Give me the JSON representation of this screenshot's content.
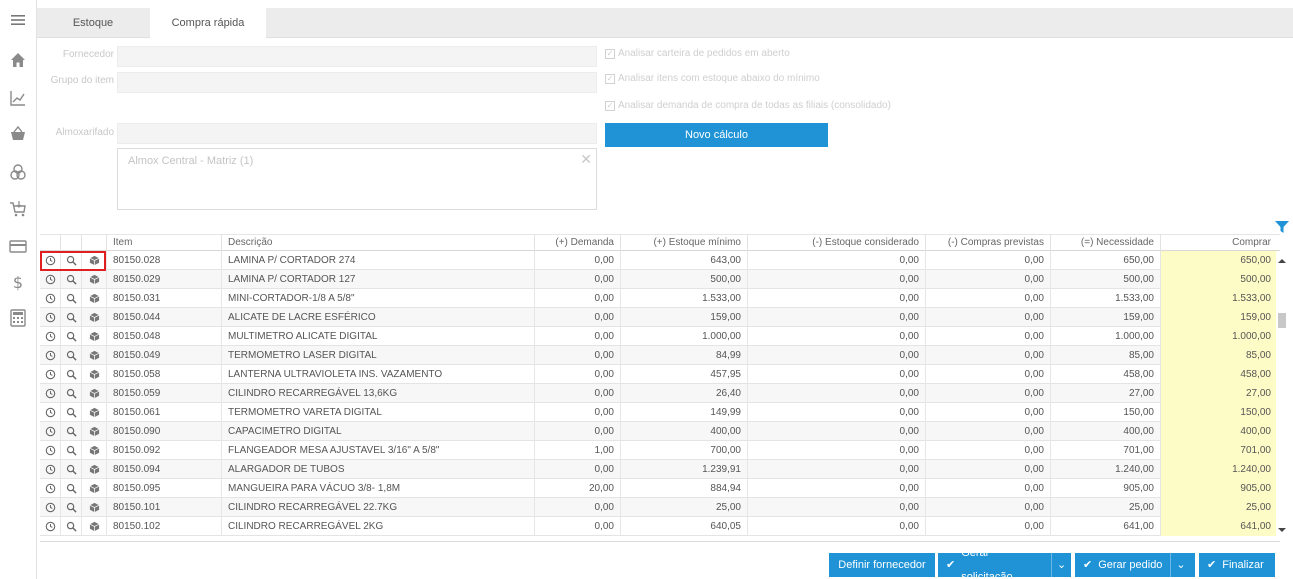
{
  "tabs": [
    {
      "label": "Estoque",
      "active": false
    },
    {
      "label": "Compra rápida",
      "active": true
    }
  ],
  "sidebar": {
    "icons": [
      "menu-icon",
      "home-icon",
      "chart-icon",
      "basket-icon",
      "coins-icon",
      "cart-icon",
      "card-icon",
      "dollar-icon",
      "calculator-icon"
    ]
  },
  "form": {
    "fornecedor_label": "Fornecedor",
    "grupo_label": "Grupo do item",
    "almox_label": "Almoxarifado",
    "almox_selected": "Almox Central - Matriz (1)",
    "check1": "Analisar carteira de pedidos em aberto",
    "check2": "Analisar itens com estoque abaixo do mínimo",
    "check3": "Analisar demanda de compra de todas as filiais (consolidado)",
    "calc_button": "Novo cálculo"
  },
  "table": {
    "headers": {
      "item": "Item",
      "descricao": "Descrição",
      "demanda": "(+) Demanda",
      "estoque_minimo": "(+) Estoque mínimo",
      "estoque_considerado": "(-) Estoque considerado",
      "compras_previstas": "(-) Compras previstas",
      "necessidade": "(=) Necessidade",
      "comprar": "Comprar"
    },
    "rows": [
      {
        "item": "80150.028",
        "descricao": "LAMINA P/ CORTADOR 274",
        "demanda": "0,00",
        "estoque_minimo": "643,00",
        "estoque_considerado": "0,00",
        "compras_previstas": "0,00",
        "necessidade": "650,00",
        "comprar": "650,00"
      },
      {
        "item": "80150.029",
        "descricao": "LAMINA P/ CORTADOR 127",
        "demanda": "0,00",
        "estoque_minimo": "500,00",
        "estoque_considerado": "0,00",
        "compras_previstas": "0,00",
        "necessidade": "500,00",
        "comprar": "500,00"
      },
      {
        "item": "80150.031",
        "descricao": "MINI-CORTADOR-1/8 A 5/8\"",
        "demanda": "0,00",
        "estoque_minimo": "1.533,00",
        "estoque_considerado": "0,00",
        "compras_previstas": "0,00",
        "necessidade": "1.533,00",
        "comprar": "1.533,00"
      },
      {
        "item": "80150.044",
        "descricao": "ALICATE DE LACRE ESFÉRICO",
        "demanda": "0,00",
        "estoque_minimo": "159,00",
        "estoque_considerado": "0,00",
        "compras_previstas": "0,00",
        "necessidade": "159,00",
        "comprar": "159,00"
      },
      {
        "item": "80150.048",
        "descricao": "MULTIMETRO ALICATE DIGITAL",
        "demanda": "0,00",
        "estoque_minimo": "1.000,00",
        "estoque_considerado": "0,00",
        "compras_previstas": "0,00",
        "necessidade": "1.000,00",
        "comprar": "1.000,00"
      },
      {
        "item": "80150.049",
        "descricao": "TERMOMETRO LASER DIGITAL",
        "demanda": "0,00",
        "estoque_minimo": "84,99",
        "estoque_considerado": "0,00",
        "compras_previstas": "0,00",
        "necessidade": "85,00",
        "comprar": "85,00"
      },
      {
        "item": "80150.058",
        "descricao": "LANTERNA ULTRAVIOLETA INS. VAZAMENTO",
        "demanda": "0,00",
        "estoque_minimo": "457,95",
        "estoque_considerado": "0,00",
        "compras_previstas": "0,00",
        "necessidade": "458,00",
        "comprar": "458,00"
      },
      {
        "item": "80150.059",
        "descricao": "CILINDRO RECARREGÁVEL 13,6KG",
        "demanda": "0,00",
        "estoque_minimo": "26,40",
        "estoque_considerado": "0,00",
        "compras_previstas": "0,00",
        "necessidade": "27,00",
        "comprar": "27,00"
      },
      {
        "item": "80150.061",
        "descricao": "TERMOMETRO VARETA DIGITAL",
        "demanda": "0,00",
        "estoque_minimo": "149,99",
        "estoque_considerado": "0,00",
        "compras_previstas": "0,00",
        "necessidade": "150,00",
        "comprar": "150,00"
      },
      {
        "item": "80150.090",
        "descricao": "CAPACIMETRO DIGITAL",
        "demanda": "0,00",
        "estoque_minimo": "400,00",
        "estoque_considerado": "0,00",
        "compras_previstas": "0,00",
        "necessidade": "400,00",
        "comprar": "400,00"
      },
      {
        "item": "80150.092",
        "descricao": "FLANGEADOR MESA AJUSTAVEL 3/16\" A 5/8\"",
        "demanda": "1,00",
        "estoque_minimo": "700,00",
        "estoque_considerado": "0,00",
        "compras_previstas": "0,00",
        "necessidade": "701,00",
        "comprar": "701,00"
      },
      {
        "item": "80150.094",
        "descricao": "ALARGADOR DE TUBOS",
        "demanda": "0,00",
        "estoque_minimo": "1.239,91",
        "estoque_considerado": "0,00",
        "compras_previstas": "0,00",
        "necessidade": "1.240,00",
        "comprar": "1.240,00"
      },
      {
        "item": "80150.095",
        "descricao": "MANGUEIRA PARA VÁCUO 3/8- 1,8M",
        "demanda": "20,00",
        "estoque_minimo": "884,94",
        "estoque_considerado": "0,00",
        "compras_previstas": "0,00",
        "necessidade": "905,00",
        "comprar": "905,00"
      },
      {
        "item": "80150.101",
        "descricao": "CILINDRO RECARREGÁVEL 22.7KG",
        "demanda": "0,00",
        "estoque_minimo": "25,00",
        "estoque_considerado": "0,00",
        "compras_previstas": "0,00",
        "necessidade": "25,00",
        "comprar": "25,00"
      },
      {
        "item": "80150.102",
        "descricao": "CILINDRO RECARREGÁVEL 2KG",
        "demanda": "0,00",
        "estoque_minimo": "640,05",
        "estoque_considerado": "0,00",
        "compras_previstas": "0,00",
        "necessidade": "641,00",
        "comprar": "641,00"
      }
    ]
  },
  "footer": {
    "definir_fornecedor": "Definir fornecedor",
    "gerar_solicitacao": "Gerar solicitação",
    "gerar_pedido": "Gerar pedido",
    "finalizar": "Finalizar"
  },
  "colors": {
    "accent": "#1f93d6",
    "highlight_border": "#e02020",
    "buy_column": "#fefcc6"
  }
}
